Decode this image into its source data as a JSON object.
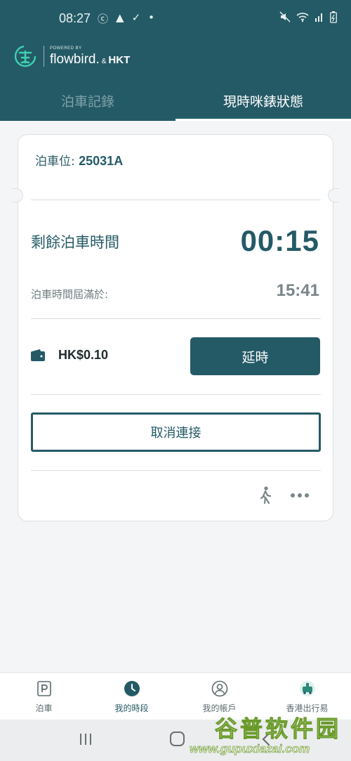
{
  "status_bar": {
    "time": "08:27",
    "left_icons": [
      "app-notification-icon",
      "warning-icon",
      "check-icon",
      "dot-icon"
    ],
    "right_icons": [
      "mute-icon",
      "wifi-icon",
      "signal-icon",
      "battery-icon"
    ]
  },
  "brand": {
    "powered_by": "POWERED BY",
    "name": "flowbird.",
    "amp": "&",
    "partner": "HKT"
  },
  "tabs": [
    {
      "label": "泊車記錄",
      "active": false
    },
    {
      "label": "現時咪錶狀態",
      "active": true
    }
  ],
  "ticket": {
    "spot_label": "泊車位:",
    "spot_value": "25031A",
    "remaining_label": "剩餘泊車時間",
    "remaining_value": "00:15",
    "expire_label": "泊車時間屆滿於:",
    "expire_value": "15:41",
    "balance": "HK$0.10",
    "extend_label": "延時",
    "cancel_label": "取消連接"
  },
  "bottom_nav": [
    {
      "label": "泊車",
      "icon": "parking-icon",
      "active": false
    },
    {
      "label": "我的時段",
      "icon": "clock-icon",
      "active": true
    },
    {
      "label": "我的帳戶",
      "icon": "account-icon",
      "active": false
    },
    {
      "label": "香港出行易",
      "icon": "hk-mobility-icon",
      "active": false
    }
  ],
  "watermark": {
    "title": "谷普软件园",
    "url": "www.gupuxiazai.com"
  },
  "colors": {
    "brand": "#245a66",
    "background": "#f4f5f6",
    "card": "#ffffff"
  }
}
